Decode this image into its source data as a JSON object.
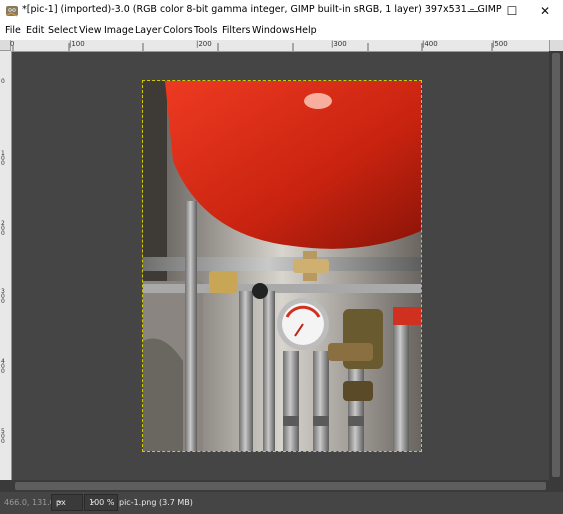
{
  "window": {
    "title": "*[pic-1] (imported)-3.0 (RGB color 8-bit gamma integer, GIMP built-in sRGB, 1 layer) 397x531 – GIMP",
    "minimize_glyph": "—",
    "maximize_glyph": "☐",
    "close_glyph": "✕"
  },
  "menu": {
    "items": [
      "File",
      "Edit",
      "Select",
      "View",
      "Image",
      "Layer",
      "Colors",
      "Tools",
      "Filters",
      "Windows",
      "Help"
    ]
  },
  "ruler_top": {
    "labels": [
      "0",
      "|100",
      "|100",
      "|200",
      "|300",
      "|400",
      "|500"
    ]
  },
  "ruler_left": {
    "labels": [
      "0",
      "100",
      "100",
      "200",
      "300",
      "400",
      "500"
    ]
  },
  "status": {
    "coords": "466.0, 131.0",
    "unit": "px",
    "zoom": "100 %",
    "file_info": "pic-1.png (3.7 MB)"
  },
  "image": {
    "description_icon": "photo-canvas",
    "tank_color": "#d6281a"
  }
}
